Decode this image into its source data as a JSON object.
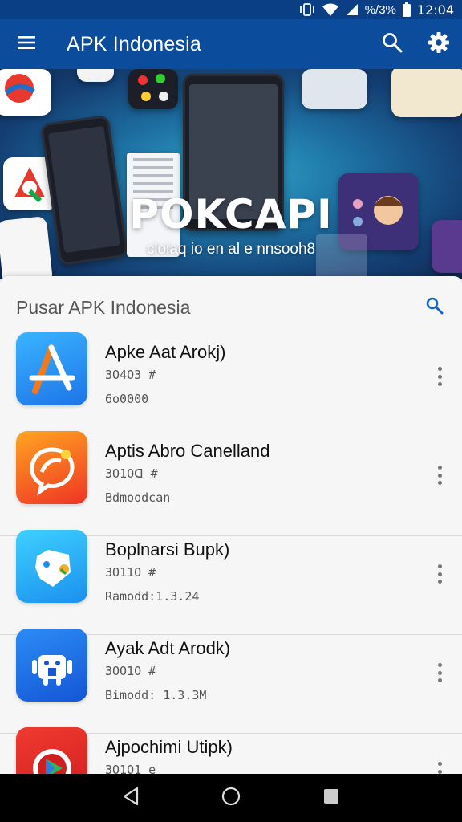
{
  "status_bar": {
    "battery_percent_label": "%/3%",
    "time": "12:04",
    "icons": [
      "vibrate-icon",
      "wifi-icon",
      "signal-icon",
      "battery-icon"
    ]
  },
  "app_bar": {
    "title": "APK Indonesia",
    "icons": {
      "menu": "menu-icon",
      "search": "search-icon",
      "settings": "gear-icon"
    },
    "color": "#0c4c9c"
  },
  "banner": {
    "title": "POKCAPI",
    "subtitle": "cloiaq io en al e nnsooh8"
  },
  "section": {
    "title": "Pusar APK Indonesia",
    "search_icon": "search-icon"
  },
  "apps": [
    {
      "name": "Apke Aat Arokj)",
      "version": "3O4O3 #",
      "size": "6o0000",
      "icon": "app-store-icon",
      "color": "#2a8ff0"
    },
    {
      "name": "Aptis Abro Canelland",
      "version": "3O1Oᗡ #",
      "size": "Bdmoodcan",
      "icon": "chat-bubble-icon",
      "color": "#f04a2a"
    },
    {
      "name": "Boplnarsi Bupk)",
      "version": "3O11O #",
      "size": "Ramodd:1.3.24",
      "icon": "mask-icon",
      "color": "#26a3ee"
    },
    {
      "name": "Ayak Adt Arodk)",
      "version": "3OO1O #",
      "size": "Bimodd: 1.3.3M",
      "icon": "android-icon",
      "color": "#1e6fe0"
    },
    {
      "name": "Ajpochimi Utipk)",
      "version": "3O1O1 e",
      "size": "",
      "icon": "play-icon",
      "color": "#e8322e"
    }
  ],
  "nav_bar": {
    "icons": [
      "back-icon",
      "home-icon",
      "recents-icon"
    ]
  }
}
